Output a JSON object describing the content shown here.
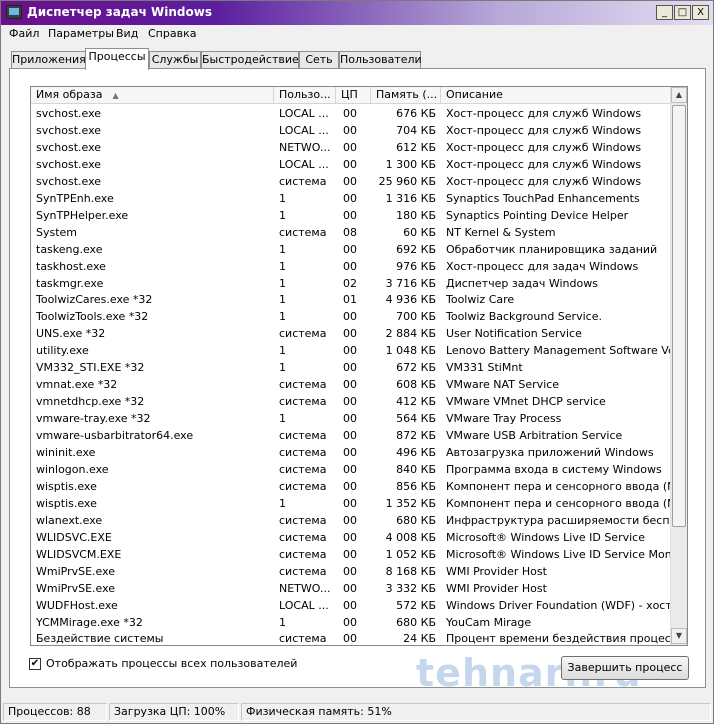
{
  "window": {
    "title": "Диспетчер задач Windows",
    "minimize": "_",
    "maximize": "□",
    "close": "X"
  },
  "menu": [
    "Файл",
    "Параметры",
    "Вид",
    "Справка"
  ],
  "tabs": [
    "Приложения",
    "Процессы",
    "Службы",
    "Быстродействие",
    "Сеть",
    "Пользователи"
  ],
  "active_tab": "Процессы",
  "table": {
    "columns": [
      "Имя образа",
      "Пользо...",
      "ЦП",
      "Память (...",
      "Описание"
    ],
    "sort_column": "Имя образа",
    "rows": [
      [
        "svchost.exe",
        "LOCAL ...",
        "00",
        "676 КБ",
        "Хост-процесс для служб Windows"
      ],
      [
        "svchost.exe",
        "LOCAL ...",
        "00",
        "704 КБ",
        "Хост-процесс для служб Windows"
      ],
      [
        "svchost.exe",
        "NETWO...",
        "00",
        "612 КБ",
        "Хост-процесс для служб Windows"
      ],
      [
        "svchost.exe",
        "LOCAL ...",
        "00",
        "1 300 КБ",
        "Хост-процесс для служб Windows"
      ],
      [
        "svchost.exe",
        "система",
        "00",
        "25 960 КБ",
        "Хост-процесс для служб Windows"
      ],
      [
        "SynTPEnh.exe",
        "1",
        "00",
        "1 316 КБ",
        "Synaptics TouchPad Enhancements"
      ],
      [
        "SynTPHelper.exe",
        "1",
        "00",
        "180 КБ",
        "Synaptics Pointing Device Helper"
      ],
      [
        "System",
        "система",
        "08",
        "60 КБ",
        "NT Kernel & System"
      ],
      [
        "taskeng.exe",
        "1",
        "00",
        "692 КБ",
        "Обработчик планировщика заданий"
      ],
      [
        "taskhost.exe",
        "1",
        "00",
        "976 КБ",
        "Хост-процесс для задач Windows"
      ],
      [
        "taskmgr.exe",
        "1",
        "02",
        "3 716 КБ",
        "Диспетчер задач Windows"
      ],
      [
        "ToolwizCares.exe *32",
        "1",
        "01",
        "4 936 КБ",
        "Toolwiz Care"
      ],
      [
        "ToolwizTools.exe *32",
        "1",
        "00",
        "700 КБ",
        "Toolwiz Background Service."
      ],
      [
        "UNS.exe *32",
        "система",
        "00",
        "2 884 КБ",
        "User Notification Service"
      ],
      [
        "utility.exe",
        "1",
        "00",
        "1 048 КБ",
        "Lenovo Battery Management Software Ve..."
      ],
      [
        "VM332_STI.EXE *32",
        "1",
        "00",
        "672 КБ",
        "VM331 StiMnt"
      ],
      [
        "vmnat.exe *32",
        "система",
        "00",
        "608 КБ",
        "VMware NAT Service"
      ],
      [
        "vmnetdhcp.exe *32",
        "система",
        "00",
        "412 КБ",
        "VMware VMnet DHCP service"
      ],
      [
        "vmware-tray.exe *32",
        "1",
        "00",
        "564 КБ",
        "VMware Tray Process"
      ],
      [
        "vmware-usbarbitrator64.exe",
        "система",
        "00",
        "872 КБ",
        "VMware USB Arbitration Service"
      ],
      [
        "wininit.exe",
        "система",
        "00",
        "496 КБ",
        "Автозагрузка приложений Windows"
      ],
      [
        "winlogon.exe",
        "система",
        "00",
        "840 КБ",
        "Программа входа в систему Windows"
      ],
      [
        "wisptis.exe",
        "система",
        "00",
        "856 КБ",
        "Компонент пера и сенсорного ввода (M..."
      ],
      [
        "wisptis.exe",
        "1",
        "00",
        "1 352 КБ",
        "Компонент пера и сенсорного ввода (M..."
      ],
      [
        "wlanext.exe",
        "система",
        "00",
        "680 КБ",
        "Инфраструктура расширяемости беспр..."
      ],
      [
        "WLIDSVC.EXE",
        "система",
        "00",
        "4 008 КБ",
        "Microsoft® Windows Live ID Service"
      ],
      [
        "WLIDSVCM.EXE",
        "система",
        "00",
        "1 052 КБ",
        "Microsoft® Windows Live ID Service Monitor"
      ],
      [
        "WmiPrvSE.exe",
        "система",
        "00",
        "8 168 КБ",
        "WMI Provider Host"
      ],
      [
        "WmiPrvSE.exe",
        "NETWO...",
        "00",
        "3 332 КБ",
        "WMI Provider Host"
      ],
      [
        "WUDFHost.exe",
        "LOCAL ...",
        "00",
        "572 КБ",
        "Windows Driver Foundation (WDF) - хост..."
      ],
      [
        "YCMMirage.exe *32",
        "1",
        "00",
        "680 КБ",
        "YouCam Mirage"
      ],
      [
        "Бездействие системы",
        "система",
        "00",
        "24 КБ",
        "Процент времени бездействия процесс..."
      ]
    ]
  },
  "show_all_users": {
    "label": "Отображать процессы всех пользователей",
    "checked": true
  },
  "end_process_button": "Завершить процесс",
  "watermark": "tehnari.ru",
  "status": {
    "processes": "Процессов: 88",
    "cpu": "Загрузка ЦП: 100%",
    "memory": "Физическая память: 51%"
  }
}
